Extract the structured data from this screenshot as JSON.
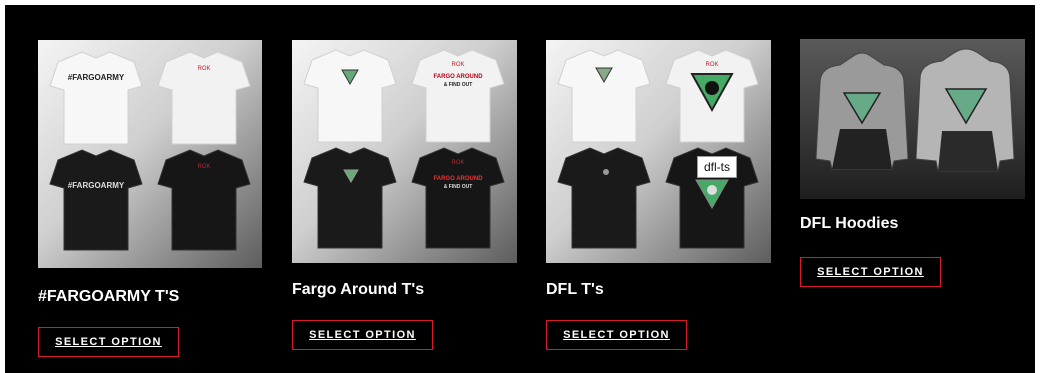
{
  "products": [
    {
      "title": "#FARGOARMY T'S",
      "button": "SELECT OPTION",
      "print_front": "#FARGOARMY",
      "brand_tag": "ROK"
    },
    {
      "title": "Fargo Around T's",
      "button": "SELECT OPTION",
      "print_back_line1": "FARGO AROUND",
      "print_back_line2": "& FIND OUT",
      "brand_tag": "ROK"
    },
    {
      "title": "DFL T's",
      "button": "SELECT OPTION",
      "brand_tag": "ROK",
      "tooltip": "dfl-ts"
    },
    {
      "title": "DFL Hoodies",
      "button": "SELECT OPTION"
    }
  ],
  "colors": {
    "background": "#000000",
    "button_border": "#d91a2b",
    "text": "#ffffff"
  }
}
